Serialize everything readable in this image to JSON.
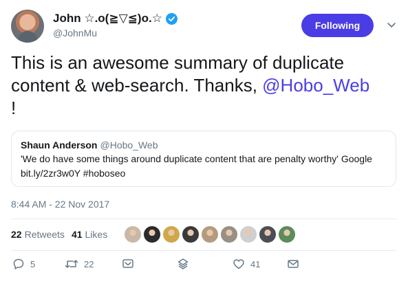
{
  "user": {
    "display_name": "John ☆.o(≧▽≦)o.☆",
    "handle": "@JohnMu",
    "follow_label": "Following"
  },
  "tweet": {
    "text_main": "This is an awesome summary of duplicate content & web-search. Thanks, ",
    "mention": "@Hobo_Web",
    "text_end": "!"
  },
  "quote": {
    "name": "Shaun Anderson",
    "handle": "@Hobo_Web",
    "text": "'We do have some things around duplicate content that are penalty worthy' Google",
    "link": "bit.ly/2zr3w0Y #hoboseo"
  },
  "timestamp": "8:44 AM - 22 Nov 2017",
  "stats": {
    "retweets_count": "22",
    "retweets_label": "Retweets",
    "likes_count": "41",
    "likes_label": "Likes"
  },
  "liker_avatars": [
    {
      "color": "#c9b8a8"
    },
    {
      "color": "#2b2b2b"
    },
    {
      "color": "#d0a84a"
    },
    {
      "color": "#3a3a3a"
    },
    {
      "color": "#b59b7d"
    },
    {
      "color": "#9a8f85"
    },
    {
      "color": "#cfcfcf"
    },
    {
      "color": "#4a4f56"
    },
    {
      "color": "#5b8c5a"
    }
  ],
  "actions": {
    "reply_count": "5",
    "retweet_count": "22",
    "like_count": "41"
  },
  "colors": {
    "accent": "#4b3de5",
    "verified": "#1da1f2",
    "muted": "#657786"
  }
}
